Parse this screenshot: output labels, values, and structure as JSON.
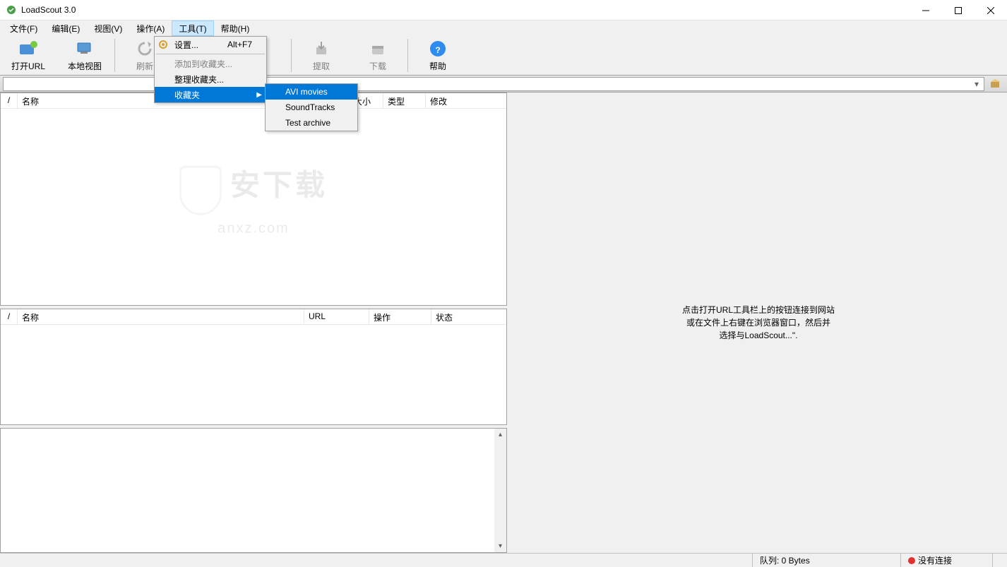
{
  "app": {
    "title": "LoadScout 3.0"
  },
  "menubar": {
    "items": [
      "文件(F)",
      "编辑(E)",
      "视图(V)",
      "操作(A)",
      "工具(T)",
      "帮助(H)"
    ]
  },
  "toolbar": {
    "open_url": "打开URL",
    "local_view": "本地视图",
    "refresh": "刷新",
    "extract": "提取",
    "download": "下载",
    "help": "帮助"
  },
  "tools_menu": {
    "settings": "设置...",
    "settings_shortcut": "Alt+F7",
    "add_fav": "添加到收藏夹...",
    "organize_fav": "整理收藏夹...",
    "favorites": "收藏夹"
  },
  "fav_submenu": {
    "items": [
      "AVI movies",
      "SoundTracks",
      "Test archive"
    ]
  },
  "columns_top": {
    "slash": "/",
    "name": "名称",
    "size": "大小",
    "type": "类型",
    "modified": "修改"
  },
  "columns_mid": {
    "slash": "/",
    "name": "名称",
    "url": "URL",
    "operation": "操作",
    "status": "状态"
  },
  "hint": {
    "line1": "点击打开URL工具栏上的按钮连接到网站",
    "line2": "或在文件上右键在浏览器窗口，然后并",
    "line3": "选择与LoadScout...\"."
  },
  "statusbar": {
    "queue": "队列: 0 Bytes",
    "conn": "没有连接"
  },
  "watermark": {
    "big": "安下载",
    "small": "anxz.com"
  }
}
